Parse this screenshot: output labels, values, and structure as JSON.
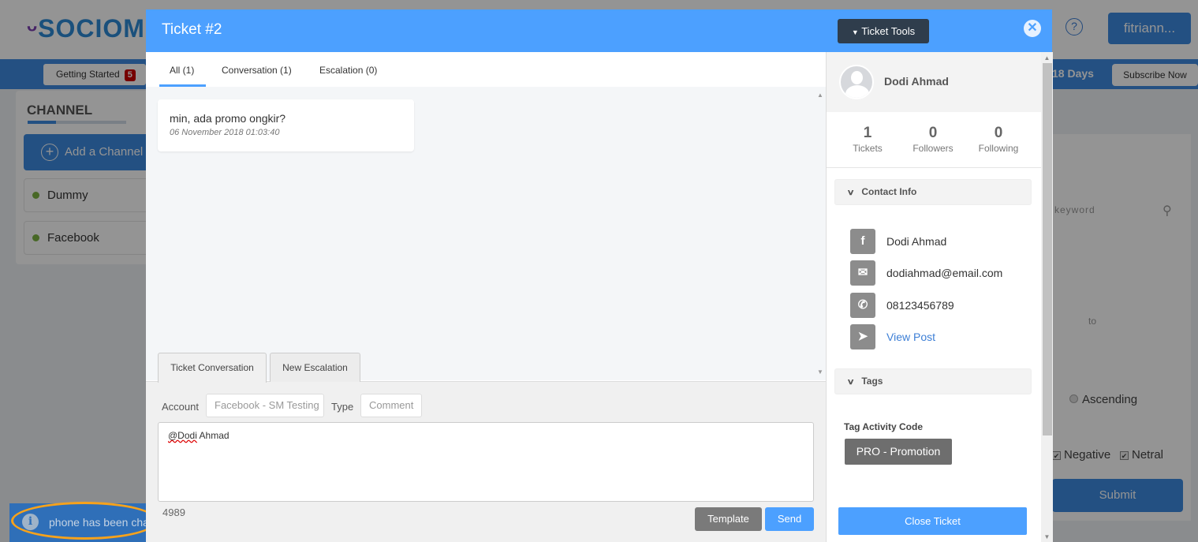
{
  "background": {
    "logo_text": "SOCIOMILE",
    "logo_visible": "SOCIOM",
    "help_icon": "question-circle-icon",
    "user_button": "fitriann...",
    "getting_started": {
      "label": "Getting Started",
      "badge": "5"
    },
    "trial_days": "18 Days",
    "subscribe_button": "Subscribe Now",
    "channel": {
      "title": "CHANNEL",
      "add_button": "Add a Channel",
      "items": [
        {
          "label": "Dummy",
          "status_color": "#7cb342"
        },
        {
          "label": "Facebook",
          "status_color": "#7cb342"
        }
      ]
    },
    "filters": {
      "keyword_placeholder": "keyword",
      "date_to": "to",
      "sort_option": "Ascending",
      "sentiment": [
        {
          "label": "Negative",
          "checked": true
        },
        {
          "label": "Netral",
          "checked": true
        }
      ],
      "submit": "Submit"
    }
  },
  "toast": {
    "text": "phone has been cha",
    "icon": "info-icon"
  },
  "modal": {
    "title": "Ticket #2",
    "tools_button": "Ticket Tools",
    "close_icon": "close-icon",
    "tabs": [
      {
        "label": "All (1)",
        "active": true
      },
      {
        "label": "Conversation (1)"
      },
      {
        "label": "Escalation (0)"
      }
    ],
    "messages": [
      {
        "text": "min, ada promo ongkir?",
        "time": "06 November 2018 01:03:40"
      }
    ],
    "compose_tabs": [
      {
        "label": "Ticket Conversation",
        "active": true
      },
      {
        "label": "New Escalation"
      }
    ],
    "account_label": "Account",
    "account_value": "Facebook - SM Testing",
    "type_label": "Type",
    "type_value": "Comment",
    "reply_mention": "@Dodi",
    "reply_rest": " Ahmad",
    "char_count": "4989",
    "template_button": "Template",
    "send_button": "Send"
  },
  "profile": {
    "name": "Dodi Ahmad",
    "stats": [
      {
        "value": "1",
        "label": "Tickets"
      },
      {
        "value": "0",
        "label": "Followers"
      },
      {
        "value": "0",
        "label": "Following"
      }
    ],
    "contact_section": "Contact Info",
    "contacts": [
      {
        "icon": "facebook-icon",
        "text": "Dodi Ahmad"
      },
      {
        "icon": "envelope-icon",
        "text": "dodiahmad@email.com"
      },
      {
        "icon": "phone-icon",
        "text": "08123456789"
      },
      {
        "icon": "location-arrow-icon",
        "text": "View Post"
      }
    ],
    "tags_section": "Tags",
    "tag_group": "Tag Activity Code",
    "tag": "PRO - Promotion",
    "close_ticket": "Close Ticket"
  },
  "colors": {
    "modal_header": "#4ca0ff",
    "primary": "#3d8be0",
    "highlight": "#f7a21b"
  }
}
